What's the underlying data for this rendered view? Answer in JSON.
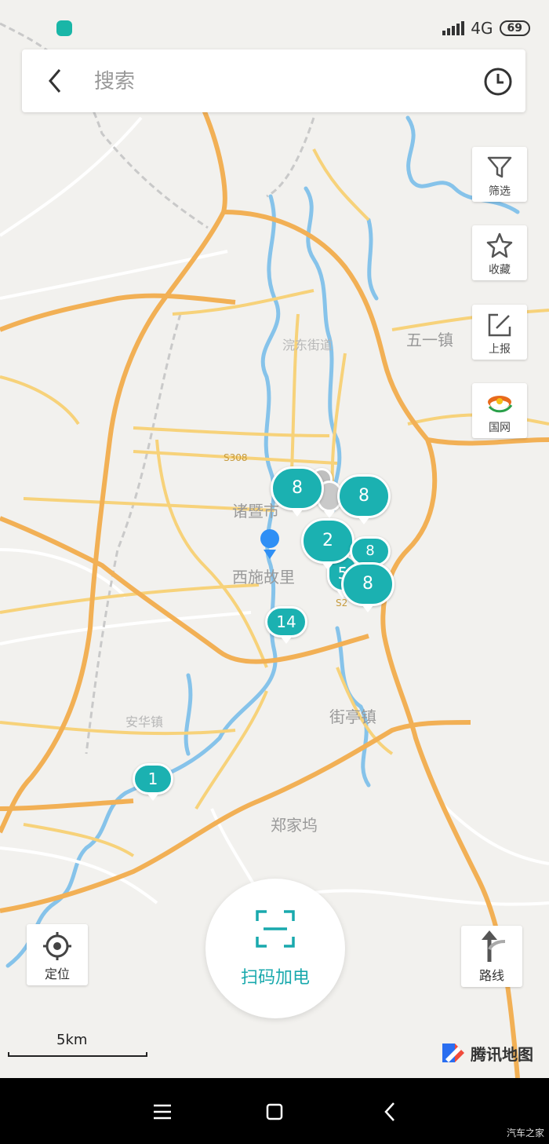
{
  "status_bar": {
    "network": "4G",
    "battery": "69"
  },
  "search": {
    "placeholder": "搜索"
  },
  "side_buttons": [
    {
      "label": "筛选",
      "icon": "filter-icon"
    },
    {
      "label": "收藏",
      "icon": "star-icon"
    },
    {
      "label": "上报",
      "icon": "edit-icon"
    },
    {
      "label": "国网",
      "icon": "state-grid-logo-icon"
    }
  ],
  "map": {
    "place_labels": [
      "诸暨市",
      "西施故里",
      "五一镇",
      "郑家坞",
      "街亭镇",
      "安华镇",
      "浣东街道"
    ],
    "road_labels": [
      "S308",
      "S2"
    ],
    "markers": [
      "8",
      "8",
      "2",
      "8",
      "5",
      "8",
      "14",
      "1"
    ]
  },
  "controls": {
    "locate_label": "定位",
    "scan_label": "扫码加电",
    "route_label": "路线"
  },
  "scale": {
    "label": "5km"
  },
  "brand": {
    "name": "腾讯地图"
  },
  "watermark": "汽车之家",
  "colors": {
    "accent": "#1bb1b1",
    "road_major": "#f4b24b",
    "water": "#7ec0ea"
  }
}
